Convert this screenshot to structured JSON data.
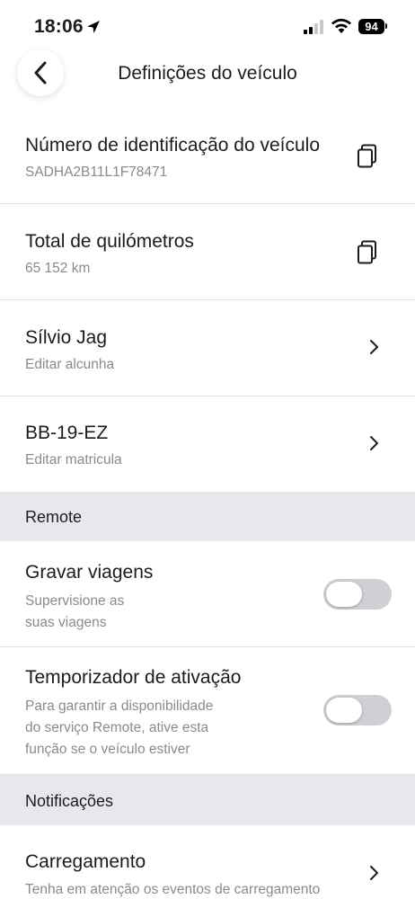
{
  "status_bar": {
    "time": "18:06",
    "battery": "94",
    "icons": [
      "location-arrow-icon",
      "signal-icon",
      "wifi-icon",
      "battery-icon"
    ]
  },
  "header": {
    "title": "Definições do veículo",
    "back_icon": "chevron-left-icon"
  },
  "vehicle": {
    "vin_label": "Número de identificação do veículo",
    "vin_value": "SADHA2B11L1F78471",
    "odometer_label": "Total de quilómetros",
    "odometer_value": "65 152 km",
    "nickname": "Sílvio Jag",
    "nickname_action": "Editar alcunha",
    "plate": "BB-19-EZ",
    "plate_action": "Editar matricula"
  },
  "remote": {
    "section_label": "Remote",
    "record_trips_label": "Gravar viagens",
    "record_trips_desc_line1": "Supervisione as",
    "record_trips_desc_line2": "suas viagens",
    "record_trips_on": false,
    "wake_timer_label": "Temporizador de ativação",
    "wake_timer_desc_line1": "Para garantir a disponibilidade",
    "wake_timer_desc_line2": "do serviço Remote, ative esta",
    "wake_timer_desc_line3": "função se o veículo estiver",
    "wake_timer_on": false
  },
  "notifications": {
    "section_label": "Notificações",
    "charging_label": "Carregamento",
    "charging_desc": "Tenha em atenção os eventos de carregamento"
  },
  "colors": {
    "section_bg": "#e7e8eb",
    "toggle_off": "#cfd0d4",
    "secondary_text": "#8a8a8e"
  }
}
